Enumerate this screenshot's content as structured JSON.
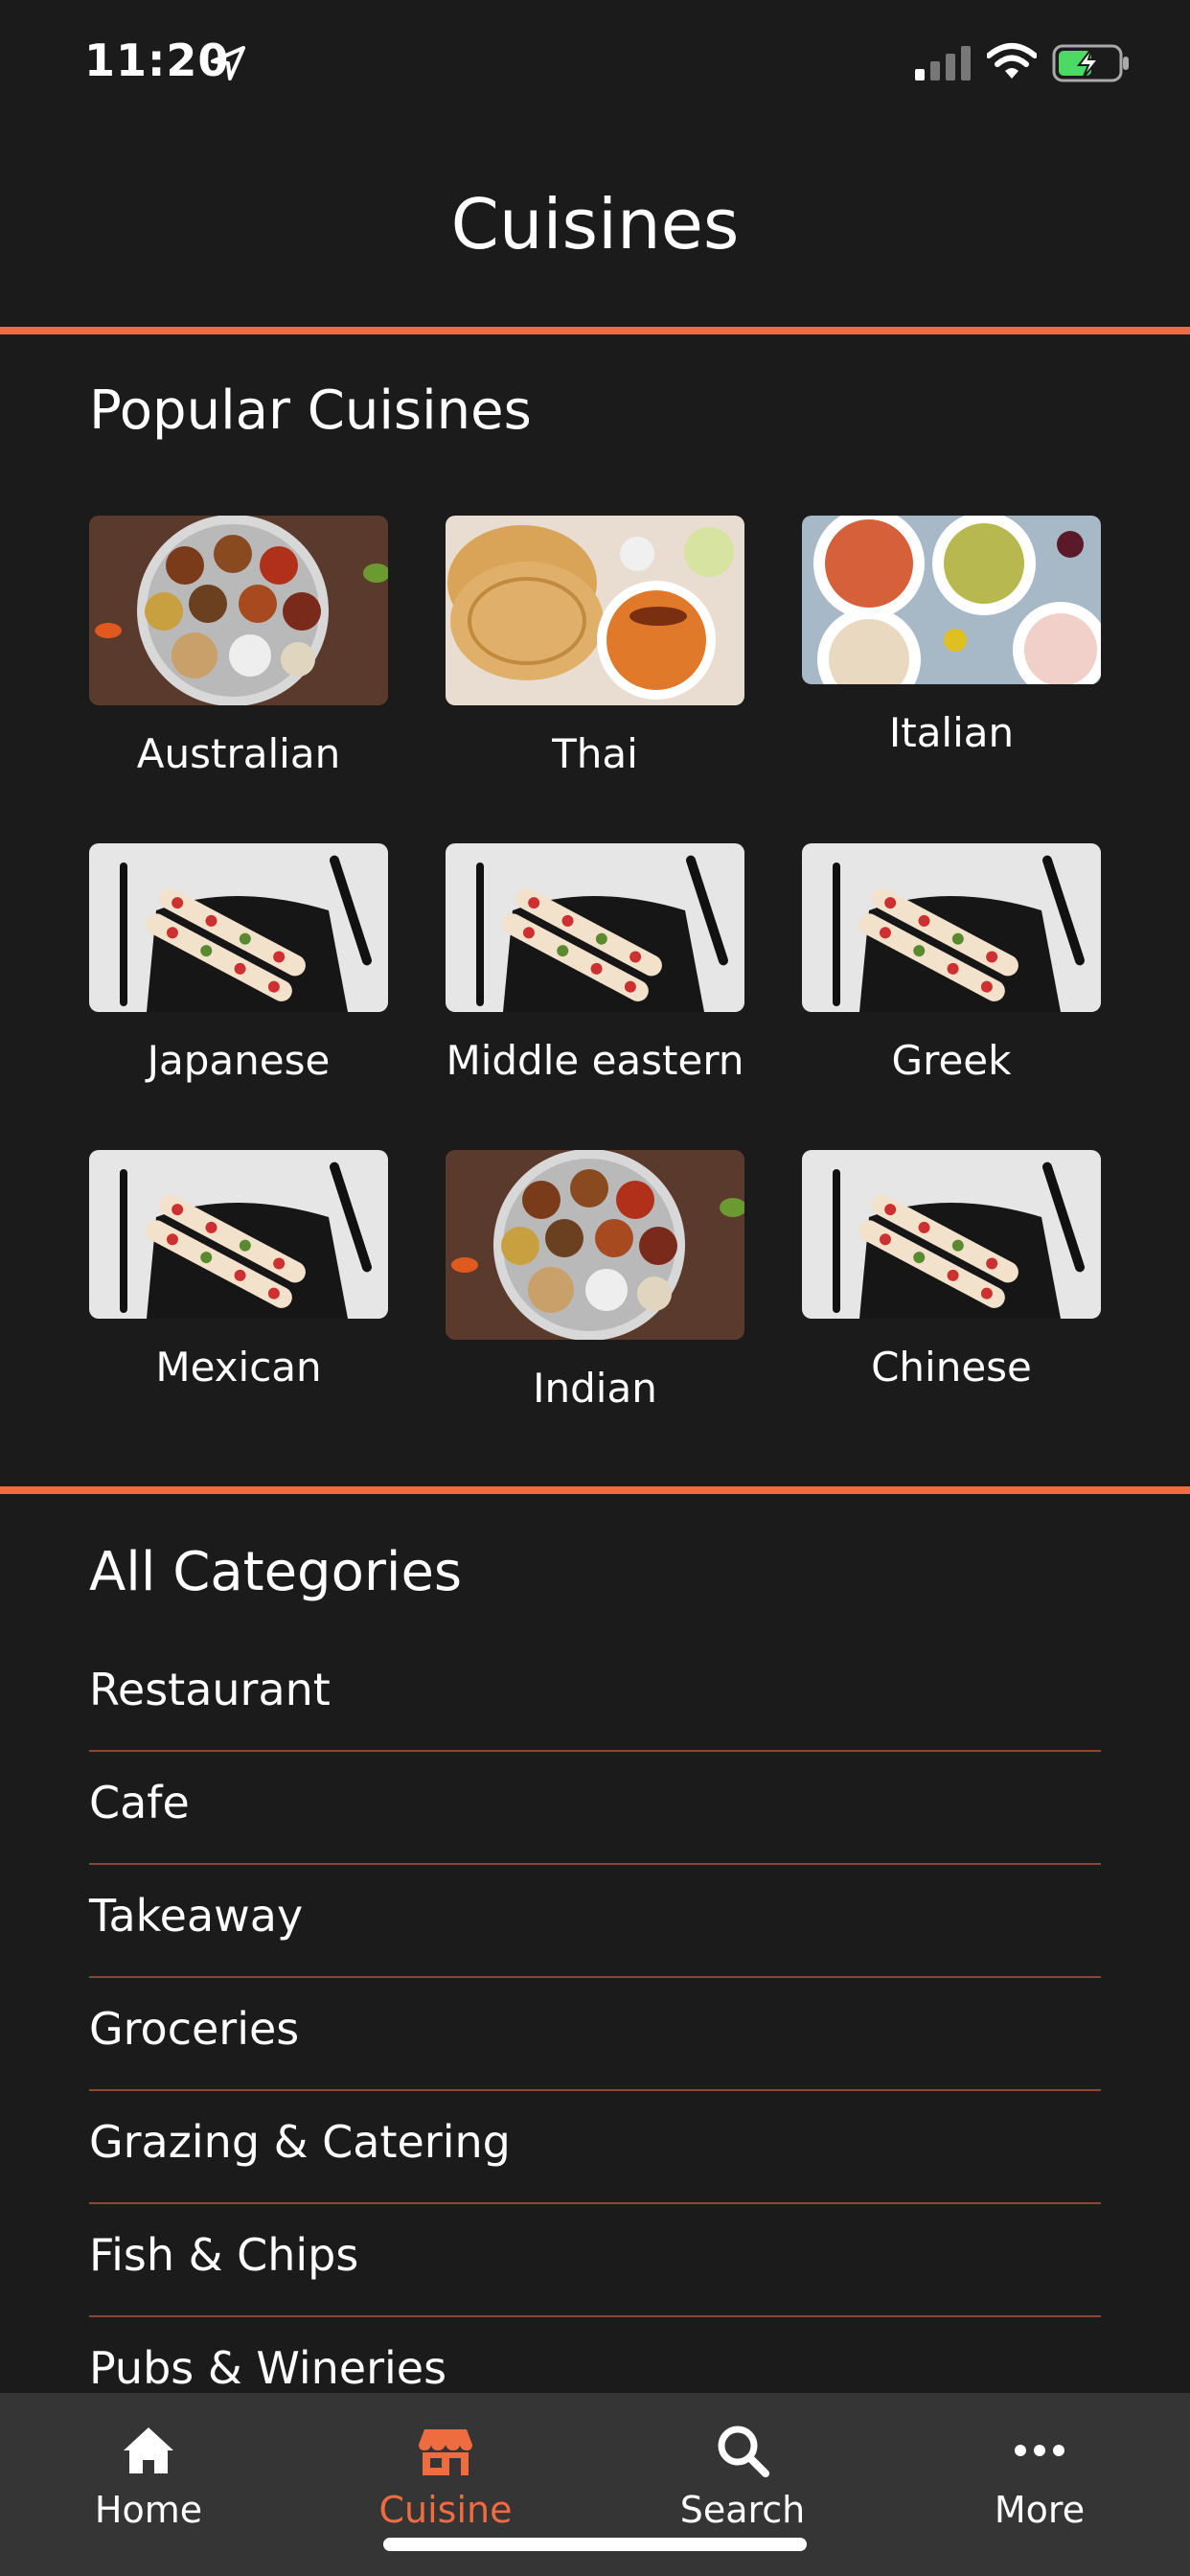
{
  "status": {
    "time": "11:20"
  },
  "header": {
    "title": "Cuisines"
  },
  "popular": {
    "title": "Popular Cuisines",
    "items": [
      {
        "label": "Australian",
        "image": "thali-plate"
      },
      {
        "label": "Thai",
        "image": "flatbread-curry"
      },
      {
        "label": "Italian",
        "image": "pasta-spread"
      },
      {
        "label": "Japanese",
        "image": "plated-rolls"
      },
      {
        "label": "Middle eastern",
        "image": "plated-rolls"
      },
      {
        "label": "Greek",
        "image": "plated-rolls"
      },
      {
        "label": "Mexican",
        "image": "plated-rolls"
      },
      {
        "label": "Indian",
        "image": "thali-plate"
      },
      {
        "label": "Chinese",
        "image": "plated-rolls"
      }
    ]
  },
  "categories": {
    "title": "All Categories",
    "items": [
      "Restaurant",
      "Cafe",
      "Takeaway",
      "Groceries",
      "Grazing & Catering",
      "Fish & Chips",
      "Pubs & Wineries"
    ]
  },
  "tabs": [
    {
      "label": "Home",
      "icon": "home-icon"
    },
    {
      "label": "Cuisine",
      "icon": "store-icon",
      "active": true
    },
    {
      "label": "Search",
      "icon": "search-icon"
    },
    {
      "label": "More",
      "icon": "more-icon"
    }
  ],
  "colors": {
    "accent": "#ee6c40",
    "background": "#1b1b1b",
    "tabbar": "#353535"
  }
}
